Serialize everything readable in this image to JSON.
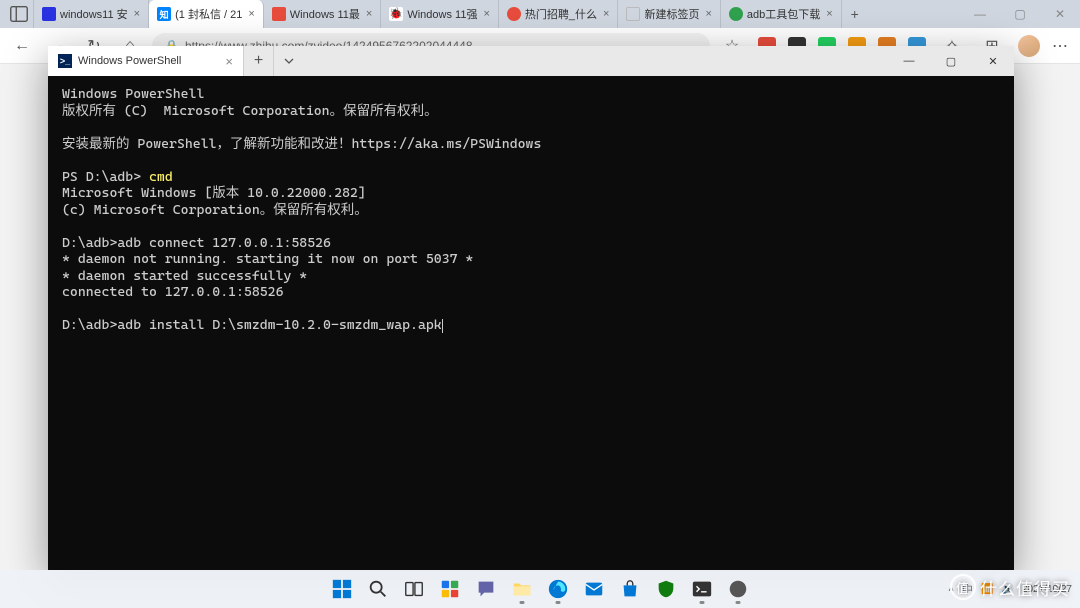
{
  "browser": {
    "tabs": [
      {
        "title": "windows11 安"
      },
      {
        "title": "(1 封私信 / 21",
        "active": true
      },
      {
        "title": "Windows 11最"
      },
      {
        "title": "Windows 11强"
      },
      {
        "title": "热门招聘_什么"
      },
      {
        "title": "新建标签页"
      },
      {
        "title": "adb工具包下载"
      }
    ],
    "url": "https://www.zhihu.com/zvideo/1424956762202044448"
  },
  "terminal": {
    "tab_title": "Windows PowerShell",
    "lines": {
      "l1": "Windows PowerShell",
      "l2": "版权所有 (C)  Microsoft Corporation。保留所有权利。",
      "l3": "安装最新的 PowerShell，了解新功能和改进！https://aka.ms/PSWindows",
      "l4a": "PS D:\\adb> ",
      "l4b": "cmd",
      "l5": "Microsoft Windows [版本 10.0.22000.282]",
      "l6": "(c) Microsoft Corporation。保留所有权利。",
      "l7": "D:\\adb>adb connect 127.0.0.1:58526",
      "l8": "* daemon not running. starting it now on port 5037 *",
      "l9": "* daemon started successfully *",
      "l10": "connected to 127.0.0.1:58526",
      "l11": "D:\\adb>adb install D:\\smzdm-10.2.0-smzdm_wap.apk"
    }
  },
  "sys": {
    "date": "2021/10/27"
  },
  "watermark": {
    "icon": "值",
    "text": "什么值得买"
  }
}
